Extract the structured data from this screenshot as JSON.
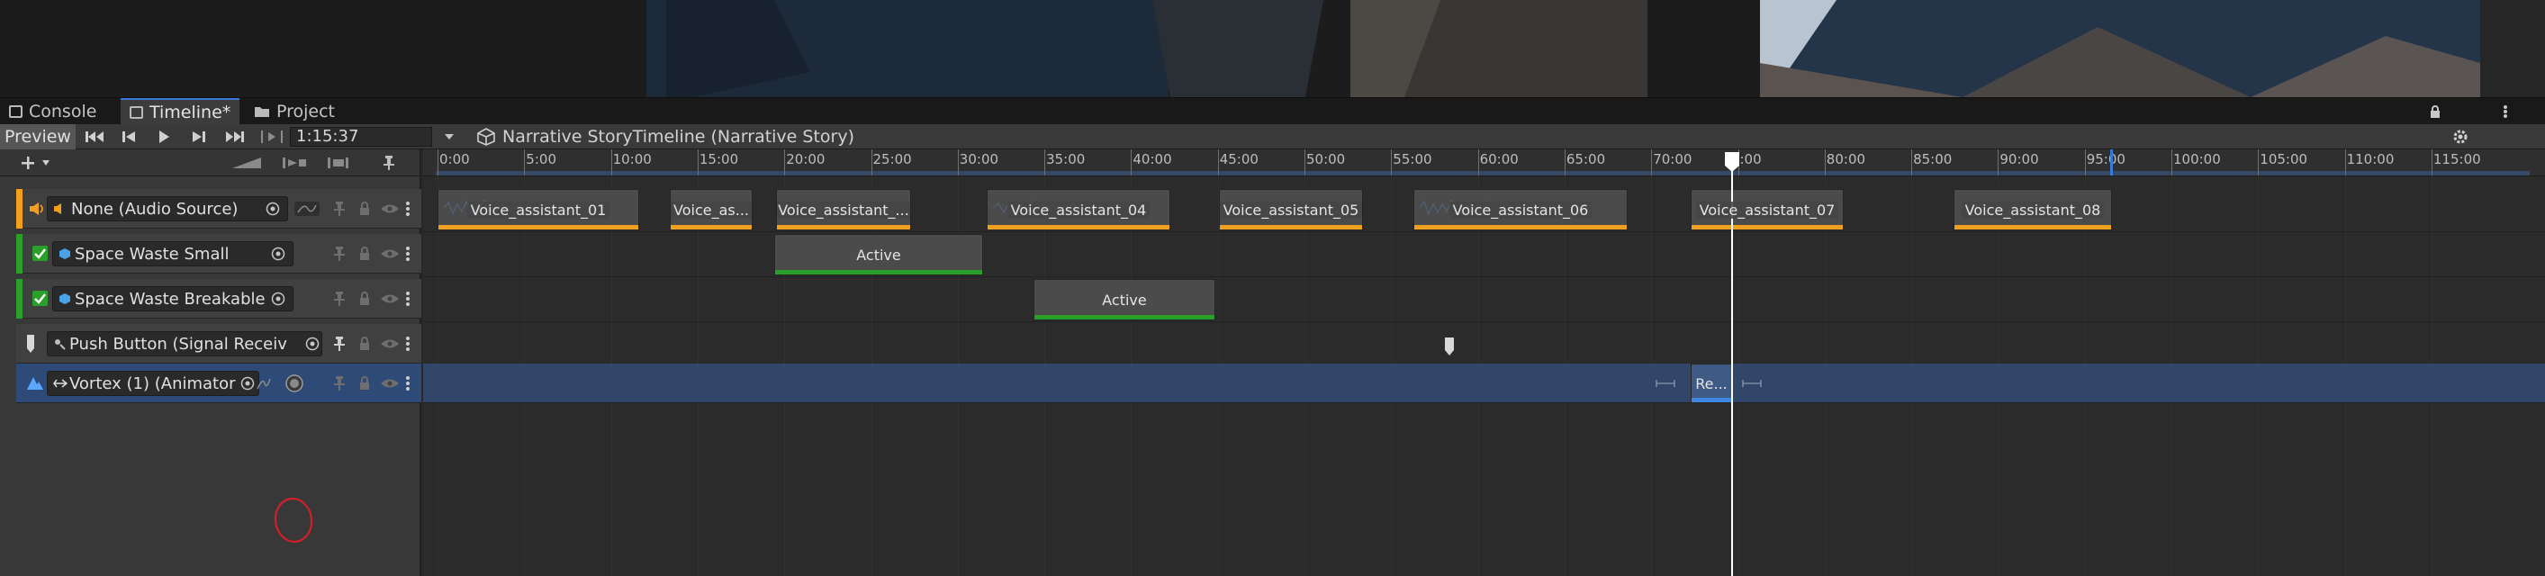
{
  "window": {
    "tabs": [
      {
        "label": "Console",
        "icon": "console-icon"
      },
      {
        "label": "Timeline*",
        "icon": "timeline-icon"
      },
      {
        "label": "Project",
        "icon": "folder-icon"
      }
    ]
  },
  "toolbar": {
    "preview_label": "Preview",
    "current_time": "1:15:37",
    "breadcrumb": "Narrative StoryTimeline (Narrative Story)"
  },
  "ruler": {
    "labels": [
      "0:00",
      "5:00",
      "10:00",
      "15:00",
      "20:00",
      "25:00",
      "30:00",
      "35:00",
      "40:00",
      "45:00",
      "50:00",
      "55:00",
      "60:00",
      "65:00",
      "70:00",
      ":00",
      "80:00",
      "85:00",
      "90:00",
      "95:00",
      "100:00",
      "105:00",
      "110:00",
      "115:00"
    ],
    "playhead_time": "1:15:37"
  },
  "tracks": [
    {
      "name": "None (Audio Source)",
      "type": "audio",
      "color": "#f0a01c"
    },
    {
      "name": "Space Waste Small",
      "type": "activation",
      "color": "#2aa02a",
      "checked": true
    },
    {
      "name": "Space Waste Breakable",
      "type": "activation",
      "color": "#2aa02a",
      "checked": true
    },
    {
      "name": "Push Button (Signal Receiv",
      "type": "signal",
      "color": "#d8d8d8"
    },
    {
      "name": "Vortex (1) (Animator",
      "type": "animation",
      "color": "#3f87e0"
    }
  ],
  "clips": {
    "audio": [
      "Voice_assistant_01",
      "Voice_as...",
      "Voice_assistant_...",
      "Voice_assistant_04",
      "Voice_assistant_05",
      "Voice_assistant_06",
      "Voice_assistant_07",
      "Voice_assistant_08"
    ],
    "activation_small": "Active",
    "activation_breakable": "Active",
    "animation": "Re..."
  },
  "colors": {
    "audio_accent": "#f0a01c",
    "activation_accent": "#2aa02a",
    "animation_accent": "#3f87e0",
    "playhead": "#ffffff",
    "annotation_circle": "#d0202a"
  }
}
